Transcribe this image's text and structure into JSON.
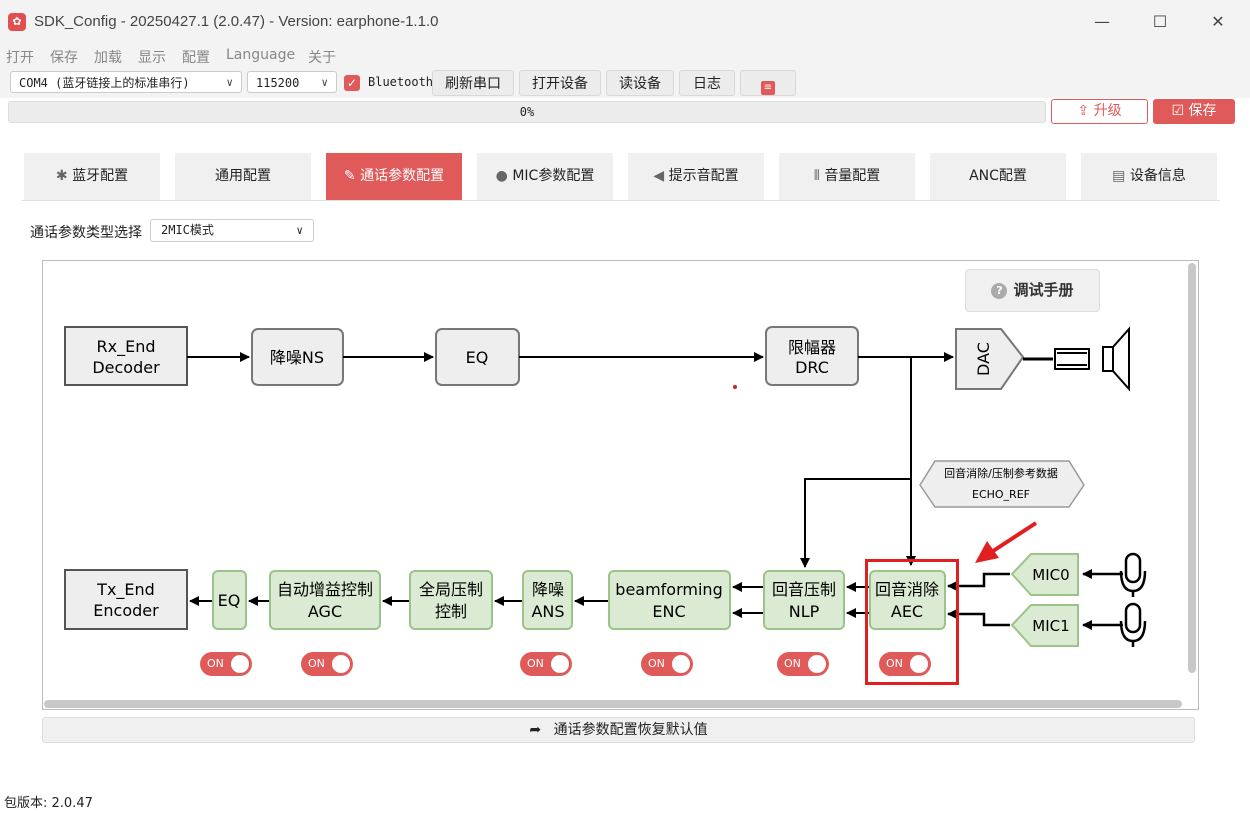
{
  "window": {
    "title": "SDK_Config -  20250427.1  (2.0.47) - Version: earphone-1.1.0",
    "minimize": "—",
    "maximize": "☐",
    "close": "✕"
  },
  "menu": [
    "打开",
    "保存",
    "加载",
    "显示",
    "配置",
    "Language",
    "关于"
  ],
  "toolbar": {
    "port": "COM4 (蓝牙链接上的标准串行)",
    "baud": "115200",
    "bluetooth_checked": true,
    "bluetooth_label": "Bluetooth",
    "refresh_port": "刷新串口",
    "open_device": "打开设备",
    "read_device": "读设备",
    "log": "日志",
    "extra_icon": "settings-sliders-icon"
  },
  "progress": {
    "value": 0,
    "text": "0%"
  },
  "actions": {
    "upgrade": "升级",
    "save": "保存"
  },
  "tabs": [
    {
      "label": "蓝牙配置",
      "icon": "bluetooth-icon",
      "glyph": "✱",
      "active": false
    },
    {
      "label": "通用配置",
      "icon": "",
      "glyph": "",
      "active": false
    },
    {
      "label": "通话参数配置",
      "icon": "edit-icon",
      "glyph": "✎",
      "active": true
    },
    {
      "label": "MIC参数配置",
      "icon": "microphone-icon",
      "glyph": "●",
      "active": false
    },
    {
      "label": "提示音配置",
      "icon": "speaker-icon",
      "glyph": "◀",
      "active": false
    },
    {
      "label": "音量配置",
      "icon": "waveform-icon",
      "glyph": "⦀",
      "active": false
    },
    {
      "label": "ANC配置",
      "icon": "",
      "glyph": "",
      "active": false
    },
    {
      "label": "设备信息",
      "icon": "clipboard-icon",
      "glyph": "▤",
      "active": false
    }
  ],
  "mode": {
    "label": "通话参数类型选择",
    "value": "2MIC模式"
  },
  "help_button": "调试手册",
  "diagram": {
    "rx_end": [
      "Rx_End",
      "Decoder"
    ],
    "rx_ns": "降噪NS",
    "rx_eq": "EQ",
    "drc": [
      "限幅器",
      "DRC"
    ],
    "dac": "DAC",
    "echo_ref": [
      "回音消除/压制参考数据",
      "ECHO_REF"
    ],
    "tx_end": [
      "Tx_End",
      "Encoder"
    ],
    "tx_eq": "EQ",
    "agc": [
      "自动增益控制",
      "AGC"
    ],
    "global": [
      "全局压制",
      "控制"
    ],
    "ans": [
      "降噪",
      "ANS"
    ],
    "enc": [
      "beamforming",
      "ENC"
    ],
    "nlp": [
      "回音压制",
      "NLP"
    ],
    "aec": [
      "回音消除",
      "AEC"
    ],
    "mic0": "MIC0",
    "mic1": "MIC1",
    "toggles": [
      {
        "name": "tx-eq",
        "label": "ON",
        "on": true
      },
      {
        "name": "agc",
        "label": "ON",
        "on": true
      },
      {
        "name": "ans",
        "label": "ON",
        "on": true
      },
      {
        "name": "enc",
        "label": "ON",
        "on": true
      },
      {
        "name": "nlp",
        "label": "ON",
        "on": true
      },
      {
        "name": "aec",
        "label": "ON",
        "on": true
      }
    ]
  },
  "restore_button": "通话参数配置恢复默认值",
  "version": "包版本: 2.0.47",
  "colors": {
    "accent": "#e05a5a",
    "block_green": "#dbead2",
    "block_green_border": "#9cc38a",
    "block_gray": "#eeeeee",
    "highlight": "#e02020"
  }
}
